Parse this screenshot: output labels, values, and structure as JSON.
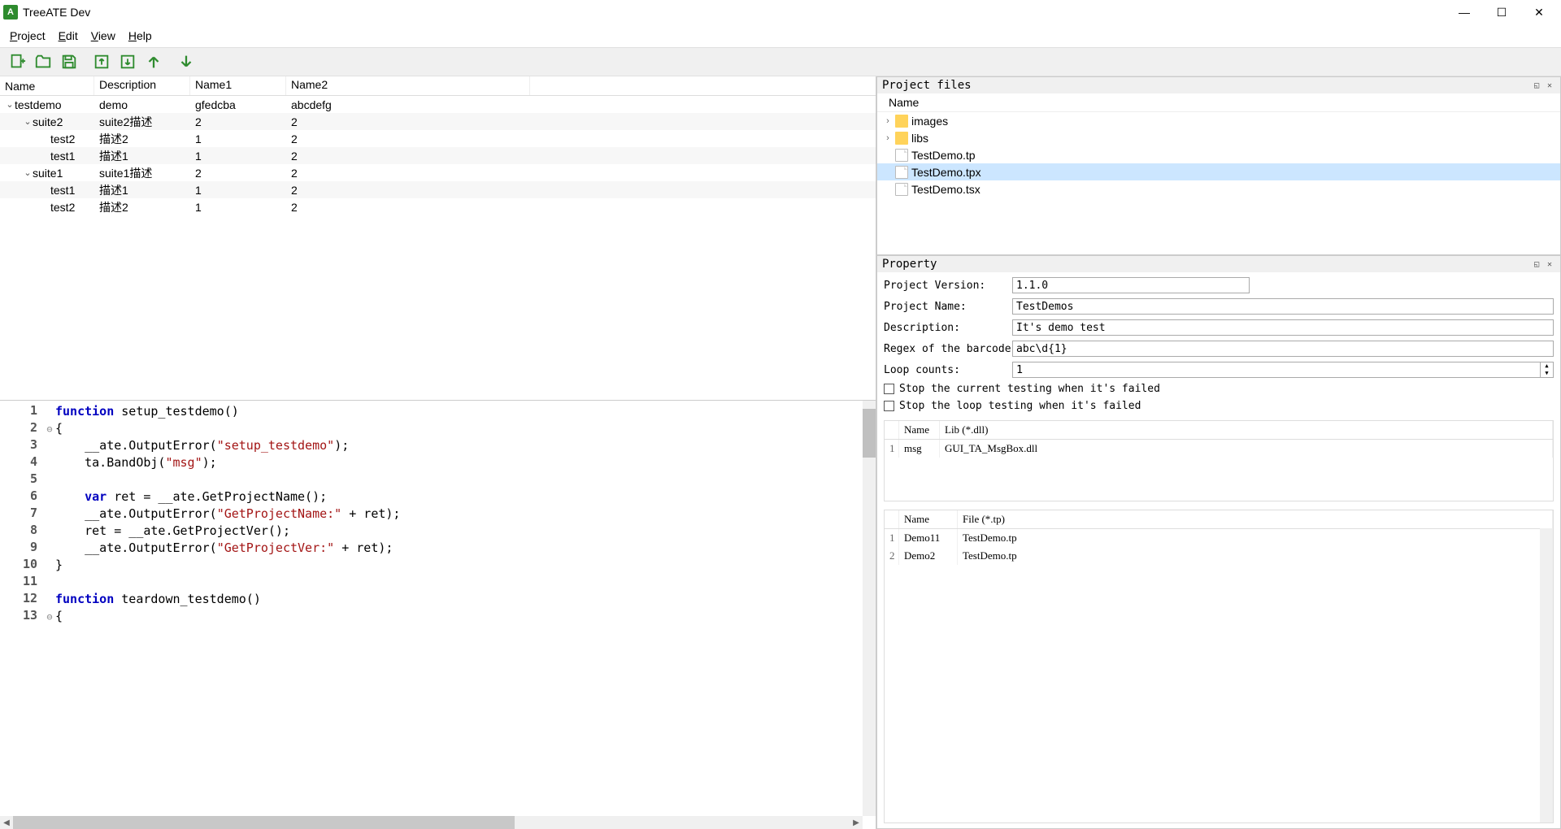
{
  "app": {
    "title": "TreeATE Dev"
  },
  "menu": {
    "project": "Project",
    "edit": "Edit",
    "view": "View",
    "help": "Help"
  },
  "tree": {
    "headers": [
      "Name",
      "Description",
      "Name1",
      "Name2"
    ],
    "rows": [
      {
        "indent": 0,
        "expand": "v",
        "name": "testdemo",
        "desc": "demo",
        "n1": "gfedcba",
        "n2": "abcdefg"
      },
      {
        "indent": 1,
        "expand": "v",
        "name": "suite2",
        "desc": "suite2描述",
        "n1": "2",
        "n2": "2"
      },
      {
        "indent": 2,
        "expand": "",
        "name": "test2",
        "desc": "描述2",
        "n1": "1",
        "n2": "2"
      },
      {
        "indent": 2,
        "expand": "",
        "name": "test1",
        "desc": "描述1",
        "n1": "1",
        "n2": "2"
      },
      {
        "indent": 1,
        "expand": "v",
        "name": "suite1",
        "desc": "suite1描述",
        "n1": "2",
        "n2": "2"
      },
      {
        "indent": 2,
        "expand": "",
        "name": "test1",
        "desc": "描述1",
        "n1": "1",
        "n2": "2"
      },
      {
        "indent": 2,
        "expand": "",
        "name": "test2",
        "desc": "描述2",
        "n1": "1",
        "n2": "2"
      }
    ]
  },
  "code": {
    "lines": [
      {
        "n": "1",
        "fold": "",
        "html": "<span class='kw'>function</span> setup_testdemo()"
      },
      {
        "n": "2",
        "fold": "⊖",
        "html": "{"
      },
      {
        "n": "3",
        "fold": "",
        "html": "    __ate.OutputError(<span class='str'>\"setup_testdemo\"</span>);"
      },
      {
        "n": "4",
        "fold": "",
        "html": "    ta.BandObj(<span class='str'>\"msg\"</span>);"
      },
      {
        "n": "5",
        "fold": "",
        "html": ""
      },
      {
        "n": "6",
        "fold": "",
        "html": "    <span class='kw'>var</span> ret = __ate.GetProjectName();"
      },
      {
        "n": "7",
        "fold": "",
        "html": "    __ate.OutputError(<span class='str'>\"GetProjectName:\"</span> + ret);"
      },
      {
        "n": "8",
        "fold": "",
        "html": "    ret = __ate.GetProjectVer();"
      },
      {
        "n": "9",
        "fold": "",
        "html": "    __ate.OutputError(<span class='str'>\"GetProjectVer:\"</span> + ret);"
      },
      {
        "n": "10",
        "fold": "",
        "html": "}"
      },
      {
        "n": "11",
        "fold": "",
        "html": ""
      },
      {
        "n": "12",
        "fold": "",
        "html": "<span class='kw'>function</span> teardown_testdemo()"
      },
      {
        "n": "13",
        "fold": "⊖",
        "html": "{"
      }
    ]
  },
  "files": {
    "title": "Project files",
    "header": "Name",
    "rows": [
      {
        "exp": "›",
        "type": "folder",
        "name": "images",
        "sel": false
      },
      {
        "exp": "›",
        "type": "folder",
        "name": "libs",
        "sel": false
      },
      {
        "exp": "",
        "type": "file",
        "name": "TestDemo.tp",
        "sel": false
      },
      {
        "exp": "",
        "type": "file",
        "name": "TestDemo.tpx",
        "sel": true
      },
      {
        "exp": "",
        "type": "file",
        "name": "TestDemo.tsx",
        "sel": false
      }
    ]
  },
  "property": {
    "title": "Property",
    "version_label": "Project Version:",
    "version": "1.1.0",
    "name_label": "Project Name:",
    "name": "TestDemos",
    "desc_label": "Description:",
    "desc": "It's demo test",
    "regex_label": "Regex of the barcode:",
    "regex": "abc\\d{1}",
    "loop_label": "Loop counts:",
    "loop": "1",
    "stop_current": "Stop the current testing when it's failed",
    "stop_loop": "Stop the loop testing when it's failed",
    "libs": {
      "headers": [
        "Name",
        "Lib (*.dll)"
      ],
      "rows": [
        {
          "idx": "1",
          "name": "msg",
          "lib": "GUI_TA_MsgBox.dll"
        }
      ]
    },
    "models": {
      "headers": [
        "Name",
        "File (*.tp)"
      ],
      "rows": [
        {
          "idx": "1",
          "name": "Demo11",
          "file": "TestDemo.tp"
        },
        {
          "idx": "2",
          "name": "Demo2",
          "file": "TestDemo.tp"
        }
      ]
    }
  }
}
